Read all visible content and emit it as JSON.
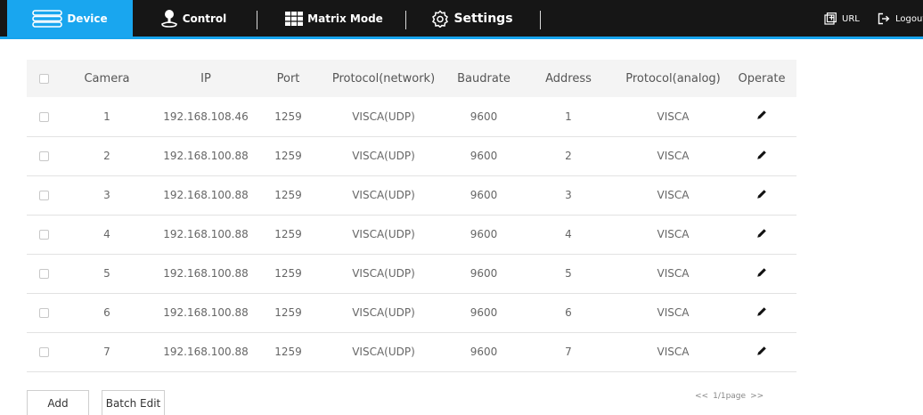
{
  "nav": {
    "tabs": [
      {
        "label": "Device",
        "icon": "device-list-icon",
        "active": true
      },
      {
        "label": "Control",
        "icon": "joystick-icon",
        "active": false
      },
      {
        "label": "Matrix Mode",
        "icon": "grid-icon",
        "active": false
      },
      {
        "label": "Settings",
        "icon": "gear-icon",
        "active": false
      }
    ],
    "url_label": "URL",
    "logout_label": "Logout"
  },
  "colors": {
    "topbar_bg": "#161616",
    "accent": "#19a6ef",
    "header_row_bg": "#f4f4f4"
  },
  "table": {
    "headers": [
      "Camera",
      "IP",
      "Port",
      "Protocol(network)",
      "Baudrate",
      "Address",
      "Protocol(analog)",
      "Operate"
    ],
    "rows": [
      {
        "camera": "1",
        "ip": "192.168.108.46",
        "port": "1259",
        "protocol_network": "VISCA(UDP)",
        "baudrate": "9600",
        "address": "1",
        "protocol_analog": "VISCA"
      },
      {
        "camera": "2",
        "ip": "192.168.100.88",
        "port": "1259",
        "protocol_network": "VISCA(UDP)",
        "baudrate": "9600",
        "address": "2",
        "protocol_analog": "VISCA"
      },
      {
        "camera": "3",
        "ip": "192.168.100.88",
        "port": "1259",
        "protocol_network": "VISCA(UDP)",
        "baudrate": "9600",
        "address": "3",
        "protocol_analog": "VISCA"
      },
      {
        "camera": "4",
        "ip": "192.168.100.88",
        "port": "1259",
        "protocol_network": "VISCA(UDP)",
        "baudrate": "9600",
        "address": "4",
        "protocol_analog": "VISCA"
      },
      {
        "camera": "5",
        "ip": "192.168.100.88",
        "port": "1259",
        "protocol_network": "VISCA(UDP)",
        "baudrate": "9600",
        "address": "5",
        "protocol_analog": "VISCA"
      },
      {
        "camera": "6",
        "ip": "192.168.100.88",
        "port": "1259",
        "protocol_network": "VISCA(UDP)",
        "baudrate": "9600",
        "address": "6",
        "protocol_analog": "VISCA"
      },
      {
        "camera": "7",
        "ip": "192.168.100.88",
        "port": "1259",
        "protocol_network": "VISCA(UDP)",
        "baudrate": "9600",
        "address": "7",
        "protocol_analog": "VISCA"
      }
    ],
    "operate_icon": "pencil-icon"
  },
  "actions": {
    "add_label": "Add",
    "batch_edit_label": "Batch Edit"
  },
  "pager": {
    "prev": "<<",
    "page_text": "1/1page",
    "next": ">>"
  }
}
